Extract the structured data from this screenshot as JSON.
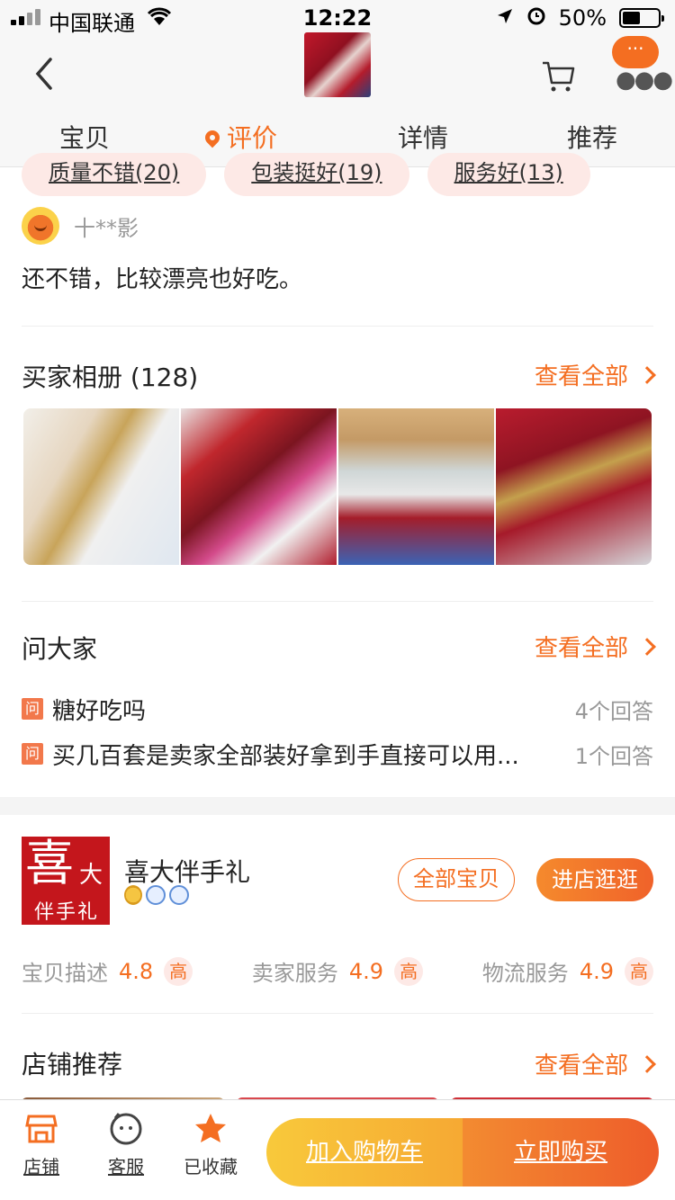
{
  "status_bar": {
    "carrier": "中国联通",
    "time": "12:22",
    "battery": "50%"
  },
  "nav": {
    "tabs": [
      {
        "label": "宝贝",
        "active": false
      },
      {
        "label": "评价",
        "active": true
      },
      {
        "label": "详情",
        "active": false
      },
      {
        "label": "推荐",
        "active": false
      }
    ],
    "more_badge": "···"
  },
  "review": {
    "tags": [
      "质量不错(20)",
      "包装挺好(19)",
      "服务好(13)"
    ],
    "username": "十**影",
    "text": "还不错，比较漂亮也好吃。"
  },
  "album": {
    "title": "买家相册 (128)",
    "see_all": "查看全部",
    "photo_count": 4
  },
  "qa": {
    "title": "问大家",
    "see_all": "查看全部",
    "badge": "问",
    "items": [
      {
        "question": "糖好吃吗",
        "answers": "4个回答"
      },
      {
        "question": "买几百套是卖家全部装好拿到手直接可以用...",
        "answers": "1个回答"
      }
    ]
  },
  "shop": {
    "logo_big": "喜",
    "logo_small": "大",
    "logo_sub": "伴手礼",
    "name": "喜大伴手礼",
    "all_items_button": "全部宝贝",
    "visit_button": "进店逛逛",
    "ratings": [
      {
        "label": "宝贝描述",
        "value": "4.8",
        "level": "高"
      },
      {
        "label": "卖家服务",
        "value": "4.9",
        "level": "高"
      },
      {
        "label": "物流服务",
        "value": "4.9",
        "level": "高"
      }
    ]
  },
  "recommend": {
    "title": "店铺推荐",
    "see_all": "查看全部"
  },
  "bottom_bar": {
    "shop_label": "店铺",
    "service_label": "客服",
    "favorite_label": "已收藏",
    "add_to_cart": "加入购物车",
    "buy_now": "立即购买"
  },
  "colors": {
    "accent": "#f46e21",
    "cart_yellow": "#f8c93b",
    "buy_orange": "#ee5c2a",
    "logo_red": "#c4161c"
  }
}
